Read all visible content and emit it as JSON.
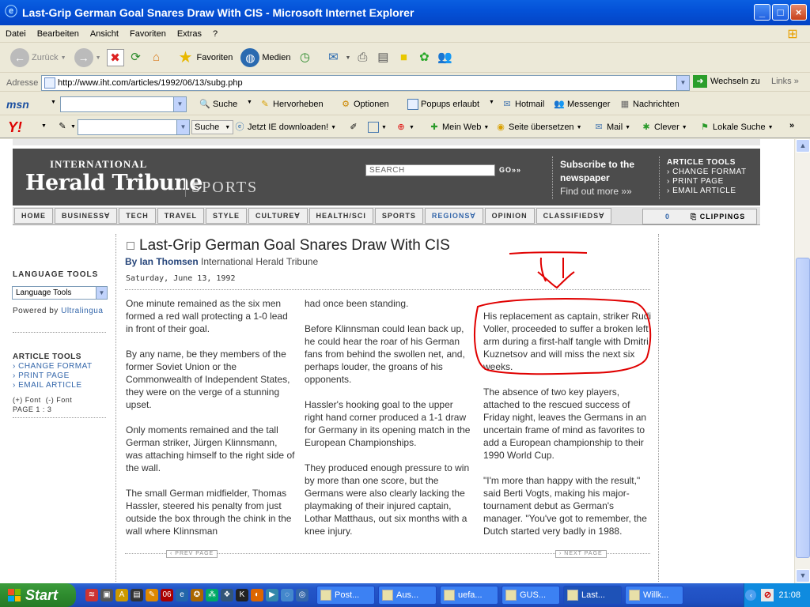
{
  "window": {
    "title": "Last-Grip German Goal Snares Draw With CIS - Microsoft Internet Explorer",
    "min": "_",
    "max": "□",
    "close": "×"
  },
  "menu": [
    "Datei",
    "Bearbeiten",
    "Ansicht",
    "Favoriten",
    "Extras",
    "?"
  ],
  "toolbar": {
    "back": "Zurück",
    "favorites": "Favoriten",
    "media": "Medien"
  },
  "address": {
    "label": "Adresse",
    "url": "http://www.iht.com/articles/1992/06/13/subg.php",
    "go": "Wechseln zu",
    "links": "Links"
  },
  "msn": {
    "logo": "msn",
    "search": "Suche",
    "highlight": "Hervorheben",
    "options": "Optionen",
    "popups": "Popups erlaubt",
    "hotmail": "Hotmail",
    "messenger": "Messenger",
    "news": "Nachrichten"
  },
  "yahoo": {
    "logo": "Y!",
    "search": "Suche",
    "ie_download": "Jetzt IE downloaden!",
    "myweb": "Mein Web",
    "translate": "Seite übersetzen",
    "mail": "Mail",
    "clever": "Clever",
    "local": "Lokale Suche",
    "more": "»"
  },
  "masthead": {
    "international": "INTERNATIONAL",
    "name": "Herald Tribune",
    "section": "SPORTS",
    "search_placeholder": "SEARCH",
    "go": "GO»»",
    "subscribe_line1": "Subscribe to the",
    "subscribe_line2": "newspaper",
    "find_more": "Find out more »»",
    "tools_title": "ARTICLE TOOLS",
    "tools": [
      "› CHANGE FORMAT",
      "› PRINT PAGE",
      "› EMAIL ARTICLE"
    ]
  },
  "nav": {
    "items": [
      "HOME",
      "BUSINESS",
      "TECH",
      "TRAVEL",
      "STYLE",
      "CULTURE",
      "HEALTH/SCI",
      "SPORTS",
      "REGIONS",
      "OPINION",
      "CLASSIFIEDS"
    ],
    "clippings_count": "0",
    "clippings": "CLIPPINGS"
  },
  "sidebar": {
    "language_tools": "LANGUAGE TOOLS",
    "language_select": "Language Tools",
    "powered_by": "Powered by",
    "ultralingua": "Ultralingua",
    "article_tools": "ARTICLE TOOLS",
    "links": [
      "› CHANGE FORMAT",
      "› PRINT PAGE",
      "› EMAIL ARTICLE"
    ],
    "font_plus": "(+) Font",
    "font_minus": "(-) Font",
    "page": "PAGE 1 : 3"
  },
  "article": {
    "title": "Last-Grip German Goal Snares Draw With CIS",
    "by": "By Ian Thomsen",
    "source": "International Herald Tribune",
    "date": "Saturday, June 13, 1992",
    "col1": [
      "One minute remained as the six men formed a red wall protecting a 1-0 lead in front of their goal.",
      "By any name, be they members of the former Soviet Union or the Commonwealth of Independent States, they were on the verge of a stunning upset.",
      "Only moments remained and the tall German striker, Jürgen Klinnsmann, was attaching himself to the right side of the wall.",
      "The small German midfielder, Thomas Hassler, steered his penalty from just outside the box through the chink in the wall where Klinnsman"
    ],
    "col2": [
      "had once been standing.",
      "Before Klinnsman could lean back up, he could hear the roar of his German fans from behind the swollen net, and, perhaps louder, the groans of his opponents.",
      "Hassler's hooking goal to the upper right hand corner produced a 1-1 draw for Germany in its opening match in the European Championships.",
      "They produced enough pressure to win by more than one score, but the Germans were also clearly lacking the playmaking of their injured captain, Lothar Matthaus, out six months with a knee injury."
    ],
    "col3": [
      "His replacement as captain, striker Rudi Voller, proceeded to suffer a broken left arm during a first-half tangle with Dmitri Kuznetsov and will miss the next six weeks.",
      "The absence of two key players, attached to the rescued success of Friday night, leaves the Germans in an uncertain frame of mind as favorites to add a European championship to their 1990 World Cup.",
      "\"I'm more than happy with the result,\" said Berti Vogts, making his major-tournament debut as German's manager. \"You've got to remember, the Dutch started very badly in 1988."
    ],
    "prev": "‹ PREV PAGE",
    "next": "› NEXT PAGE"
  },
  "annotation_color": "#e00000",
  "taskbar": {
    "start": "Start",
    "tasks": [
      "Post...",
      "Aus...",
      "uefa...",
      "GUS...",
      "Last...",
      "Willk..."
    ],
    "time": "21:08"
  }
}
